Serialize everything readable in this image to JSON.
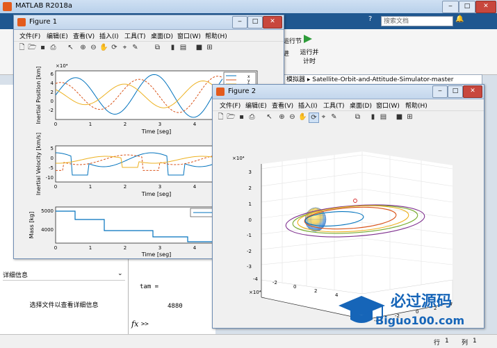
{
  "main": {
    "title": "MATLAB R2018a",
    "search_placeholder": "搜索文档",
    "ribbon": {
      "run_section": "运行节",
      "run_time": "运行并\n计时",
      "advance": "进"
    },
    "path": "模拟器 ▸ Satellite-Orbit-and-Attitude-Simulator-master",
    "details": {
      "header": "详细信息",
      "message": "选择文件以查看详细信息"
    },
    "command": {
      "line1": "tam =",
      "value": "4880",
      "prompt": ">>"
    },
    "status": {
      "row_label": "行",
      "row": "1",
      "col_label": "列",
      "col": "1"
    },
    "accent": "#1f5790"
  },
  "figure1": {
    "title": "Figure 1",
    "menu": [
      "文件(F)",
      "编辑(E)",
      "查看(V)",
      "插入(I)",
      "工具(T)",
      "桌面(D)",
      "窗口(W)",
      "帮助(H)"
    ],
    "plots": [
      {
        "ylabel": "Inertial Position [km]",
        "xlabel": "Time [seg]",
        "exponent": "×10⁴",
        "yticks": [
          "6",
          "4",
          "2",
          "0",
          "-2"
        ],
        "xticks": [
          "0",
          "1",
          "2",
          "3",
          "4"
        ],
        "legend": [
          "x",
          "y",
          "z"
        ]
      },
      {
        "ylabel": "Inertial Velocity [km/s]",
        "xlabel": "Time [seg]",
        "yticks": [
          "5",
          "0",
          "-5",
          "-10"
        ],
        "xticks": [
          "0",
          "1",
          "2",
          "3",
          "4"
        ]
      },
      {
        "ylabel": "Mass [kg]",
        "xlabel": "Time [seg]",
        "yticks": [
          "5000",
          "4000"
        ],
        "xticks": [
          "0",
          "1",
          "2",
          "3",
          "4"
        ]
      }
    ]
  },
  "figure2": {
    "title": "Figure 2",
    "menu": [
      "文件(F)",
      "编辑(E)",
      "查看(V)",
      "插入(I)",
      "工具(T)",
      "桌面(D)",
      "窗口(W)",
      "帮助(H)"
    ],
    "z_exponent": "×10⁴",
    "zticks": [
      "3",
      "2",
      "1",
      "0",
      "-1",
      "-2",
      "-3"
    ],
    "x_exponent": "×10⁴",
    "xticks": [
      "-4",
      "-2",
      "0",
      "2",
      "4"
    ],
    "yticks": [
      "-4",
      "-2",
      "0",
      "2",
      "4"
    ],
    "orbit_colors": [
      "#7e2f8e",
      "#77ac30",
      "#edb120",
      "#d95319",
      "#0072bd"
    ]
  },
  "watermark": {
    "cn": "必过源码",
    "url": "Biguo100.com"
  }
}
